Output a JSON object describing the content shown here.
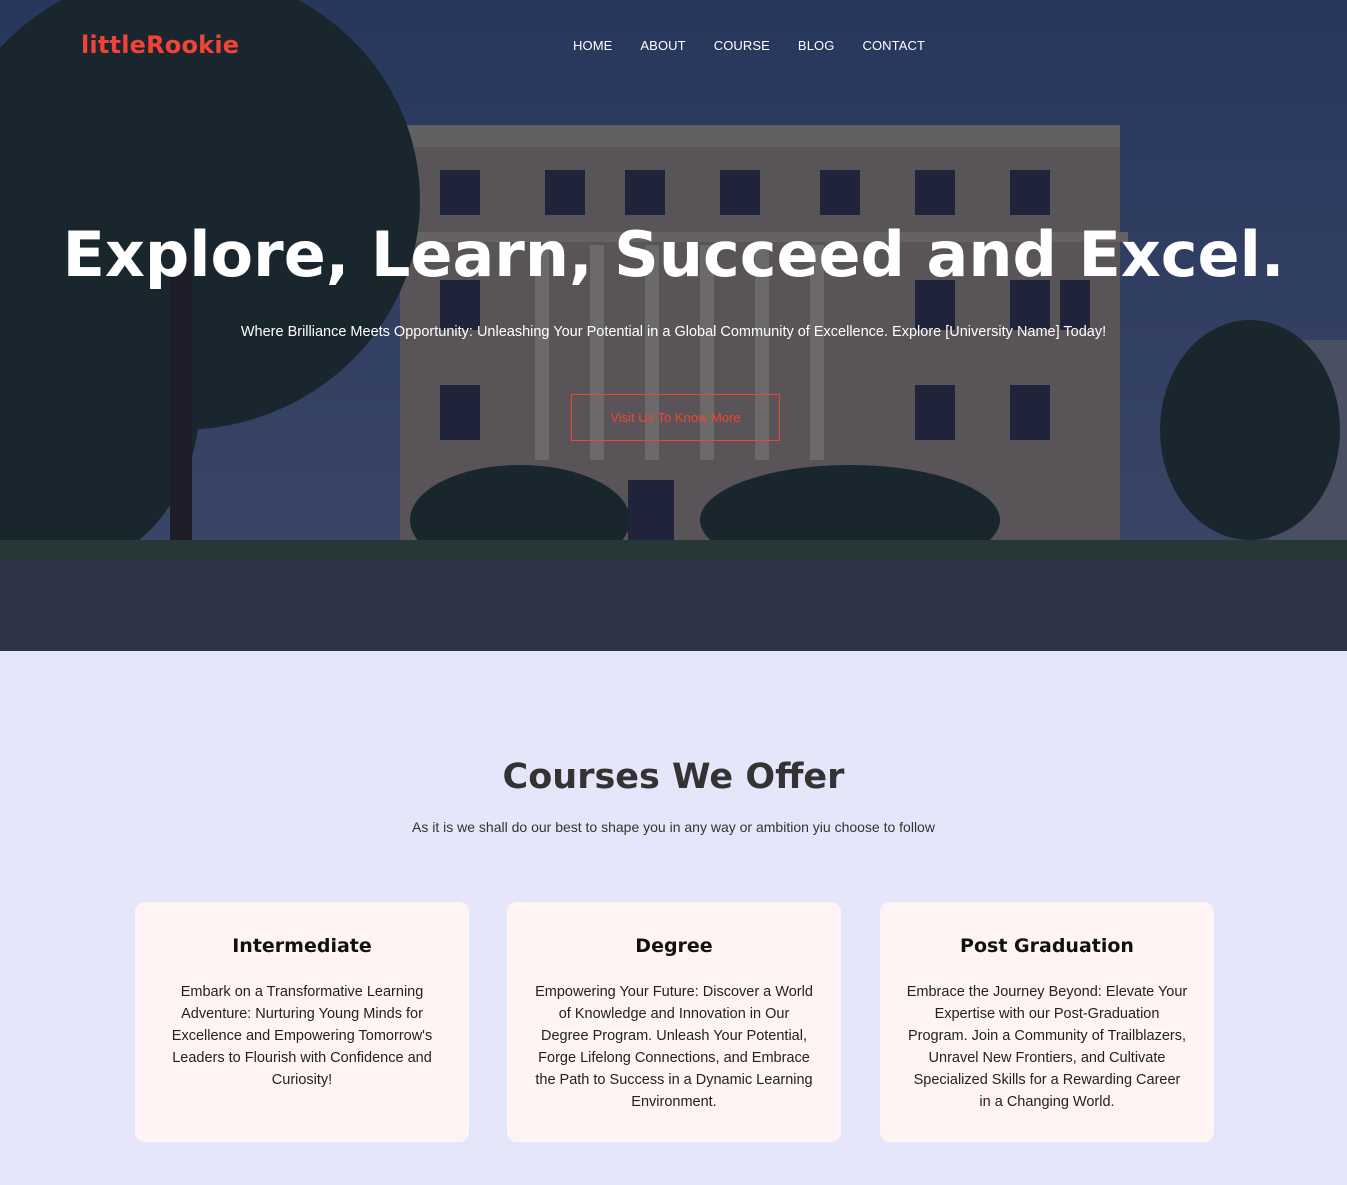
{
  "brand": {
    "logo_text": "littleRookie",
    "accent": "#f44336"
  },
  "nav": {
    "items": [
      {
        "label": "HOME"
      },
      {
        "label": "ABOUT"
      },
      {
        "label": "COURSE"
      },
      {
        "label": "BLOG"
      },
      {
        "label": "CONTACT"
      }
    ]
  },
  "hero": {
    "title": "Explore, Learn, Succeed and Excel.",
    "subtitle": "Where Brilliance Meets Opportunity: Unleashing Your Potential in a Global Community of Excellence. Explore [University Name] Today!",
    "cta_label": "Visit Us To Know More"
  },
  "courses": {
    "title": "Courses We Offer",
    "subtitle": "As it is we shall do our best to shape you in any way or ambition yiu choose to follow",
    "cards": [
      {
        "title": "Intermediate",
        "text": "Embark on a Transformative Learning Adventure: Nurturing Young Minds for Excellence and Empowering Tomorrow's Leaders to Flourish with Confidence and Curiosity!"
      },
      {
        "title": "Degree",
        "text": "Empowering Your Future: Discover a World of Knowledge and Innovation in Our Degree Program. Unleash Your Potential, Forge Lifelong Connections, and Embrace the Path to Success in a Dynamic Learning Environment."
      },
      {
        "title": "Post Graduation",
        "text": "Embrace the Journey Beyond: Elevate Your Expertise with our Post-Graduation Program. Join a Community of Trailblazers, Unravel New Frontiers, and Cultivate Specialized Skills for a Rewarding Career in a Changing World."
      }
    ]
  },
  "colors": {
    "courses_bg": "#e6e6fb",
    "card_bg": "#fff4f3",
    "text_dark": "#333333"
  }
}
